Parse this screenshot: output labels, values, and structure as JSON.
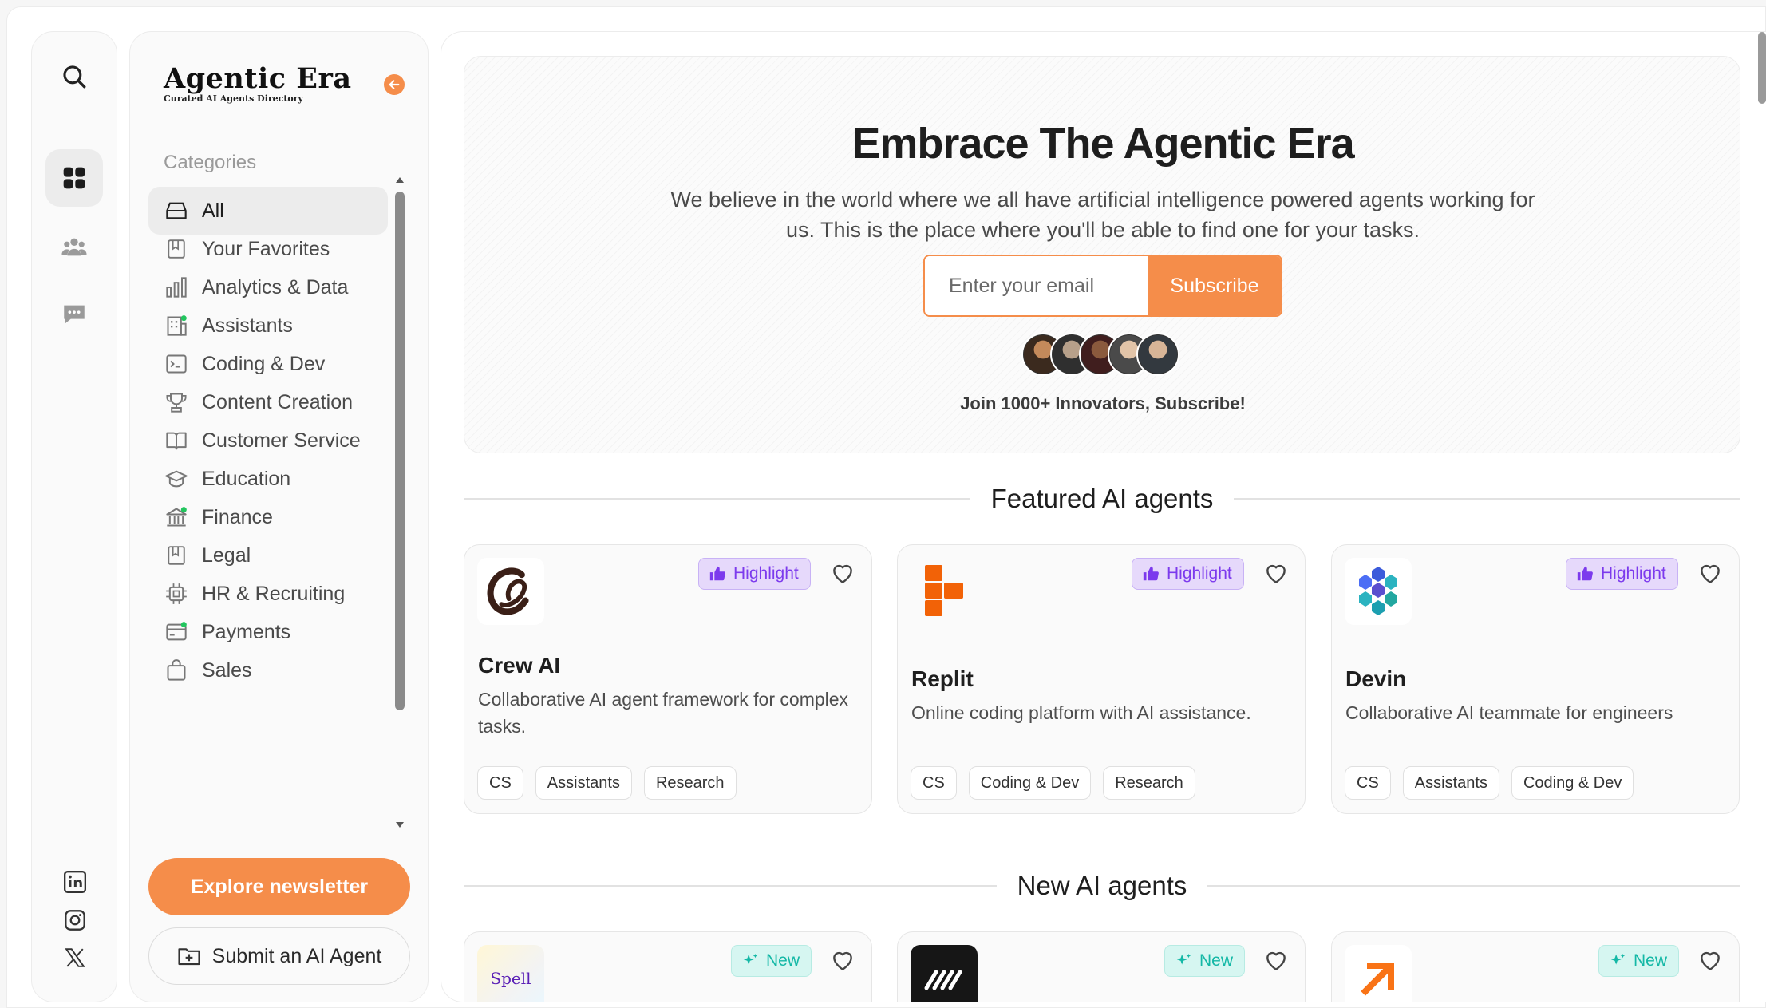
{
  "brand": {
    "title": "Agentic Era",
    "subtitle": "Curated AI Agents Directory"
  },
  "sidebar": {
    "categories_heading": "Categories",
    "items": [
      {
        "label": "All",
        "icon": "inbox-icon"
      },
      {
        "label": "Your Favorites",
        "icon": "bookmark-icon"
      },
      {
        "label": "Analytics & Data",
        "icon": "bar-chart-icon"
      },
      {
        "label": "Assistants",
        "icon": "building-icon"
      },
      {
        "label": "Coding & Dev",
        "icon": "terminal-icon"
      },
      {
        "label": "Content Creation",
        "icon": "trophy-icon"
      },
      {
        "label": "Customer Service",
        "icon": "book-open-icon"
      },
      {
        "label": "Education",
        "icon": "graduation-cap-icon"
      },
      {
        "label": "Finance",
        "icon": "bank-icon"
      },
      {
        "label": "Legal",
        "icon": "bookmark-icon"
      },
      {
        "label": "HR & Recruiting",
        "icon": "chip-icon"
      },
      {
        "label": "Payments",
        "icon": "credit-card-icon"
      },
      {
        "label": "Sales",
        "icon": "bag-icon"
      }
    ],
    "explore_label": "Explore newsletter",
    "submit_label": "Submit an AI Agent"
  },
  "hero": {
    "title": "Embrace The Agentic Era",
    "text": "We believe in the world where we all have artificial intelligence powered agents working for us. This is the place where you'll be able to find one for your tasks.",
    "email_placeholder": "Enter your email",
    "subscribe_label": "Subscribe",
    "join_text": "Join 1000+ Innovators, Subscribe!"
  },
  "featured": {
    "title": "Featured AI agents",
    "badge_label": "Highlight",
    "cards": [
      {
        "name": "Crew AI",
        "desc": "Collaborative AI agent framework for complex tasks.",
        "tags": [
          "CS",
          "Assistants",
          "Research"
        ]
      },
      {
        "name": "Replit",
        "desc": "Online coding platform with AI assistance.",
        "tags": [
          "CS",
          "Coding & Dev",
          "Research"
        ]
      },
      {
        "name": "Devin",
        "desc": "Collaborative AI teammate for engineers",
        "tags": [
          "CS",
          "Assistants",
          "Coding & Dev"
        ]
      }
    ]
  },
  "new_agents": {
    "title": "New AI agents",
    "badge_label": "New",
    "first_logo_text": "Spell"
  },
  "colors": {
    "accent": "#f58d4a",
    "highlight": "#7c3aed",
    "new": "#14b8a6"
  }
}
